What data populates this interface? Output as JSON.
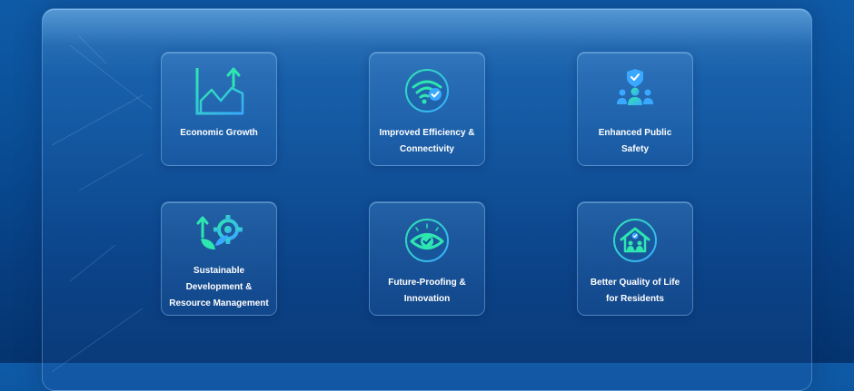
{
  "benefits": [
    {
      "label": "Economic Growth",
      "icon": "growth-chart-icon"
    },
    {
      "label": "Improved Efficiency &\nConnectivity",
      "icon": "wifi-check-icon"
    },
    {
      "label": "Enhanced Public\nSafety",
      "icon": "shield-people-icon"
    },
    {
      "label": "Sustainable\nDevelopment &\nResource Management",
      "icon": "plant-gear-icon"
    },
    {
      "label": "Future-Proofing &\nInnovation",
      "icon": "eye-check-icon"
    },
    {
      "label": "Better Quality of Life\nfor Residents",
      "icon": "home-people-icon"
    }
  ],
  "colors": {
    "icon_start": "#2ee6b0",
    "icon_end": "#3aa8ff",
    "text": "#ffffff"
  }
}
